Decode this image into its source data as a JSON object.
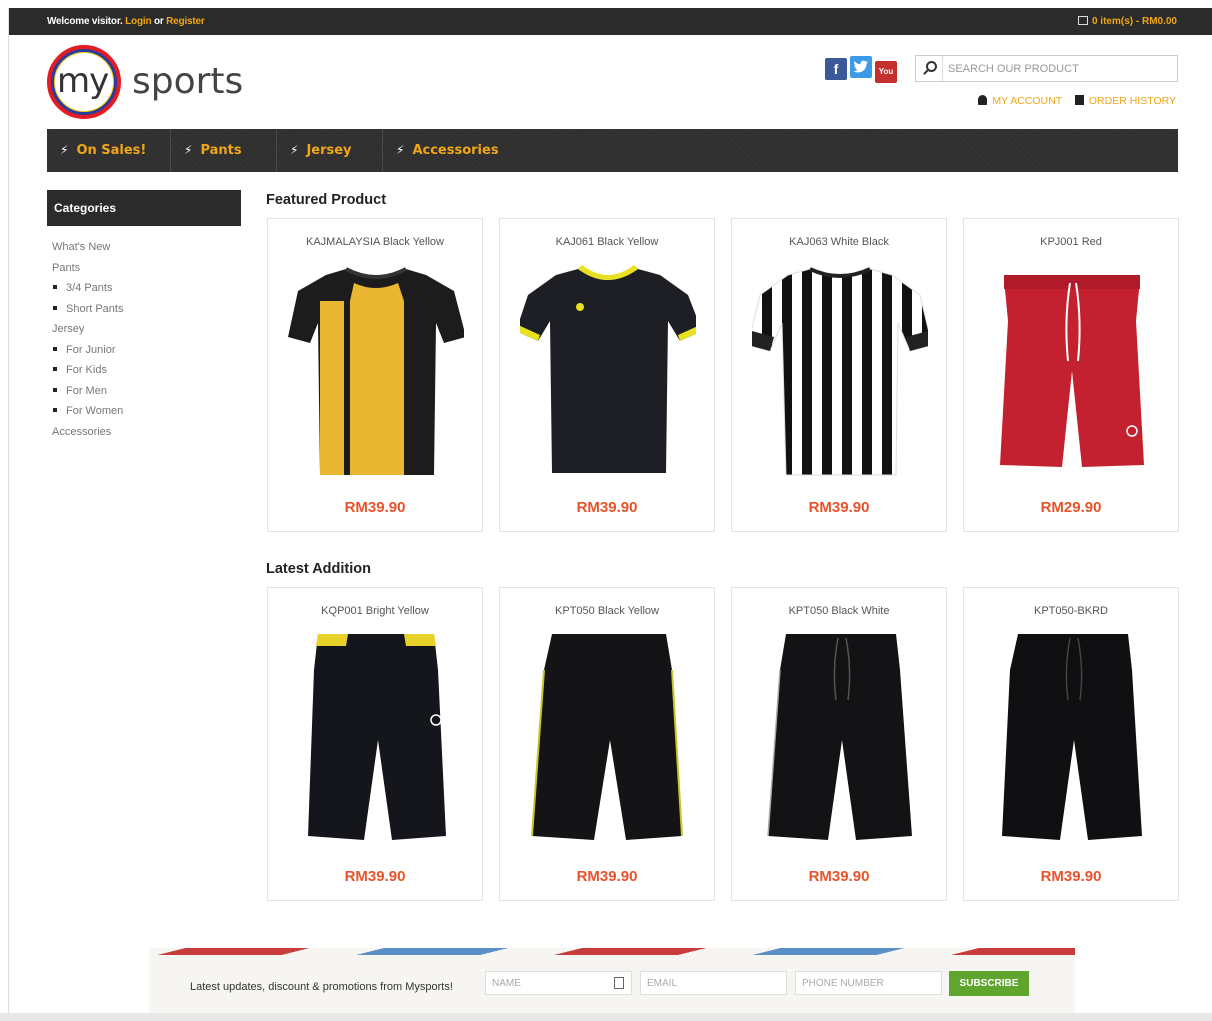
{
  "topbar": {
    "welcome_text": "Welcome visitor.",
    "login": "Login",
    "or": "or",
    "register": "Register",
    "cart": "0 item(s) - RM0.00"
  },
  "logo": {
    "my": "my",
    "sports": "sports"
  },
  "social": {
    "facebook": "f",
    "twitter": "t",
    "youtube": "You"
  },
  "search": {
    "placeholder": "SEARCH OUR PRODUCT"
  },
  "account": {
    "my_account": "MY ACCOUNT",
    "order_history": "ORDER HISTORY"
  },
  "nav": {
    "items": [
      {
        "label": "On Sales!"
      },
      {
        "label": "Pants"
      },
      {
        "label": "Jersey"
      },
      {
        "label": "Accessories"
      }
    ]
  },
  "sidebar": {
    "heading": "Categories",
    "items": [
      {
        "label": "What's New"
      },
      {
        "label": "Pants"
      },
      {
        "label": "3/4 Pants"
      },
      {
        "label": "Short Pants"
      },
      {
        "label": "Jersey"
      },
      {
        "label": "For Junior"
      },
      {
        "label": "For Kids"
      },
      {
        "label": "For Men"
      },
      {
        "label": "For Women"
      },
      {
        "label": "Accessories"
      }
    ]
  },
  "featured": {
    "title": "Featured Product",
    "products": [
      {
        "name": "KAJMALAYSIA Black Yellow",
        "price": "RM39.90",
        "icon": "black-yellow-jersey"
      },
      {
        "name": "KAJ061 Black Yellow",
        "price": "RM39.90",
        "icon": "black-jersey"
      },
      {
        "name": "KAJ063 White Black",
        "price": "RM39.90",
        "icon": "striped-jersey"
      },
      {
        "name": "KPJ001 Red",
        "price": "RM29.90",
        "icon": "red-shorts"
      }
    ]
  },
  "latest": {
    "title": "Latest Addition",
    "products": [
      {
        "name": "KQP001 Bright Yellow",
        "price": "RM39.90",
        "icon": "black-pants"
      },
      {
        "name": "KPT050 Black Yellow",
        "price": "RM39.90",
        "icon": "black-pants"
      },
      {
        "name": "KPT050 Black White",
        "price": "RM39.90",
        "icon": "black-pants"
      },
      {
        "name": "KPT050-BKRD",
        "price": "RM39.90",
        "icon": "black-pants"
      }
    ]
  },
  "newsletter": {
    "text": "Latest updates, discount & promotions from Mysports!",
    "name_placeholder": "NAME",
    "email_placeholder": "EMAIL",
    "phone_placeholder": "PHONE NUMBER",
    "subscribe": "SUBSCRIBE"
  },
  "colors": {
    "accent": "#f0a616",
    "price": "#e8542c",
    "subscribe": "#5fa52e",
    "dark": "#2b2b2b"
  }
}
